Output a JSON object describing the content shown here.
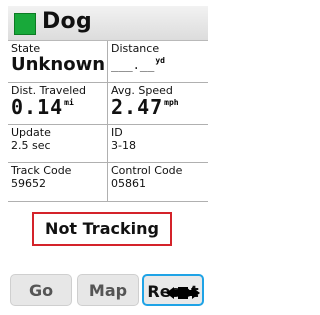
{
  "header": {
    "title": "Dog",
    "color": "#18a93a"
  },
  "fields": {
    "state": {
      "label": "State",
      "value": "Unknown"
    },
    "distance": {
      "label": "Distance",
      "value": "___.__",
      "unit": "yd"
    },
    "dist_traveled": {
      "label": "Dist. Traveled",
      "value": "0.14",
      "unit": "mi"
    },
    "avg_speed": {
      "label": "Avg. Speed",
      "value": "2.47",
      "unit": "mph"
    },
    "update": {
      "label": "Update",
      "value": "2.5 sec"
    },
    "id": {
      "label": "ID",
      "value": "3-18"
    },
    "track_code": {
      "label": "Track Code",
      "value": "59652"
    },
    "control_code": {
      "label": "Control Code",
      "value": "05861"
    }
  },
  "status": {
    "text": "Not Tracking",
    "border_color": "#d4232a"
  },
  "buttons": {
    "go": "Go",
    "map": "Map",
    "reset": "Reset",
    "selected": "reset",
    "selected_color": "#1fa3e6"
  }
}
